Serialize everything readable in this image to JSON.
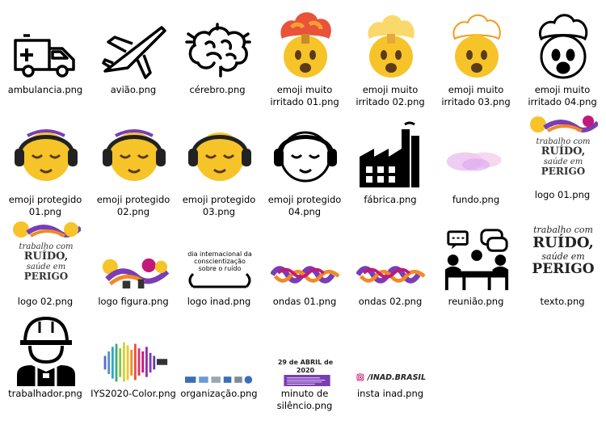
{
  "files": [
    {
      "name": "ambulancia.png",
      "icon": "ambulance-icon"
    },
    {
      "name": "avião.png",
      "icon": "airplane-icon"
    },
    {
      "name": "cérebro.png",
      "icon": "brain-icon"
    },
    {
      "name": "emoji muito irritado 01.png",
      "icon": "exploding-head-emoji-icon"
    },
    {
      "name": "emoji muito irritado 02.png",
      "icon": "exploding-head-emoji-icon"
    },
    {
      "name": "emoji muito irritado 03.png",
      "icon": "exploding-head-emoji-icon"
    },
    {
      "name": "emoji muito irritado 04.png",
      "icon": "exploding-head-outline-icon"
    },
    {
      "name": "emoji protegido 01.png",
      "icon": "headphones-emoji-icon"
    },
    {
      "name": "emoji protegido 02.png",
      "icon": "headphones-emoji-icon"
    },
    {
      "name": "emoji protegido 03.png",
      "icon": "headphones-emoji-icon"
    },
    {
      "name": "emoji protegido 04.png",
      "icon": "headphones-outline-icon"
    },
    {
      "name": "fábrica.png",
      "icon": "factory-icon"
    },
    {
      "name": "fundo.png",
      "icon": "background-image-icon"
    },
    {
      "name": "logo 01.png",
      "icon": "campaign-logo-icon",
      "text": [
        "trabalho com",
        "RUÍDO,",
        "saúde em",
        "PERIGO"
      ]
    },
    {
      "name": "logo 02.png",
      "icon": "campaign-logo-icon",
      "text": [
        "trabalho com",
        "RUÍDO,",
        "saúde em",
        "PERIGO"
      ]
    },
    {
      "name": "logo figura.png",
      "icon": "logo-figure-icon"
    },
    {
      "name": "logo inad.png",
      "icon": "inad-logo-icon",
      "text": "dia internacional da conscientização sobre o ruído"
    },
    {
      "name": "ondas 01.png",
      "icon": "waves-icon"
    },
    {
      "name": "ondas 02.png",
      "icon": "waves-icon"
    },
    {
      "name": "reunião.png",
      "icon": "meeting-icon"
    },
    {
      "name": "texto.png",
      "icon": "campaign-text-icon",
      "text": [
        "trabalho com",
        "RUÍDO,",
        "saúde em",
        "PERIGO"
      ]
    },
    {
      "name": "trabalhador.png",
      "icon": "worker-icon"
    },
    {
      "name": "IYS2020-Color.png",
      "icon": "iys2020-logo-icon"
    },
    {
      "name": "organização.png",
      "icon": "organization-logos-icon"
    },
    {
      "name": "minuto de silêncio.png",
      "icon": "minute-of-silence-icon",
      "text": "29 de ABRIL de 2020"
    },
    {
      "name": "insta inad.png",
      "icon": "instagram-icon",
      "text": "/INAD.BRASIL"
    }
  ],
  "colors": {
    "emoji_yellow": "#F6C429",
    "emoji_orange": "#F29A1B",
    "purple": "#7A3DB5",
    "magenta": "#C2187A",
    "orange": "#F08A24"
  }
}
